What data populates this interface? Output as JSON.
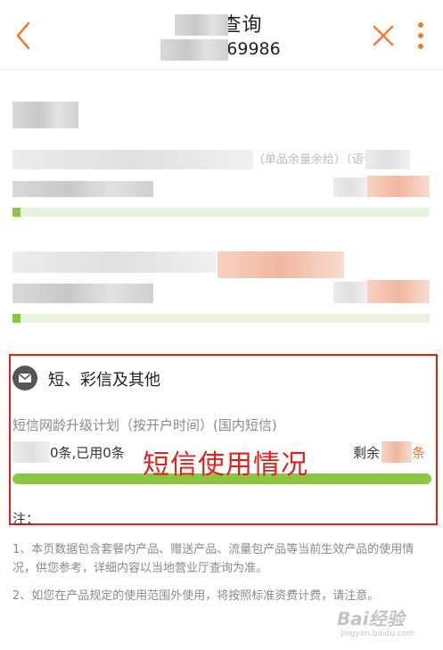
{
  "header": {
    "title": "余量查询",
    "subtitle_visible": "69986",
    "accent_color": "#f07a36"
  },
  "plans": [
    {
      "label_visible": "（单品余量余给）（语音）",
      "progress_fraction": 0.02
    },
    {
      "label_visible": "",
      "progress_fraction": 0.02
    }
  ],
  "sms": {
    "section_title": "短、彩信及其他",
    "icon": "envelope-icon",
    "plan_name": "短信网龄升级计划（按开户时间）(国内短信)",
    "usage_visible": "0条,已用0条",
    "remaining_label": "剩余",
    "remaining_unit": "条",
    "progress_fraction": 1.0
  },
  "annotation": {
    "text": "短信使用情况",
    "color": "#e0201d"
  },
  "notes": {
    "label": "注：",
    "items": [
      "1、本页数据包含套餐内产品、赠送产品、流量包产品等当前生效产品的使用情况，供您参考，详细内容以当地营业厅查询为准。",
      "2、如您在产品规定的使用范围外使用，将按照标准资费计费，请注意。"
    ]
  },
  "watermark": {
    "text": "Bai经验",
    "sub": "jingyan.baidu.com"
  },
  "colors": {
    "progress_green": "#8cc63f",
    "progress_track": "#e8f2dc",
    "highlight_red": "#e0201d"
  }
}
